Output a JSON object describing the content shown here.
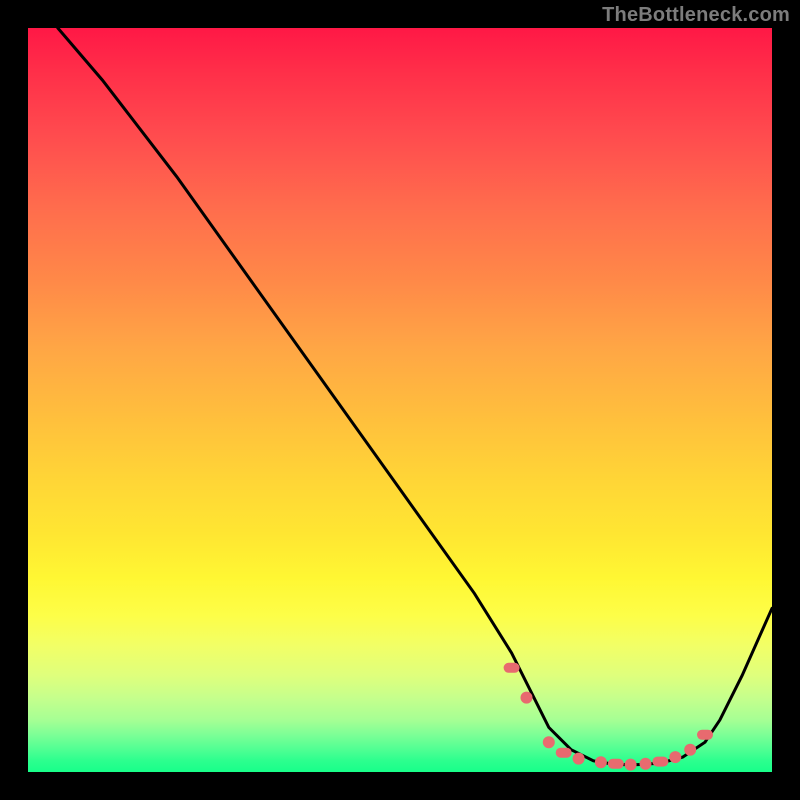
{
  "watermark": "TheBottleneck.com",
  "colors": {
    "background": "#000000",
    "gradient_top": "#ff1846",
    "gradient_mid": "#ffe632",
    "gradient_bottom": "#18ff8a",
    "curve": "#000000",
    "marker_fill": "#e86a6f",
    "marker_stroke": "#000000"
  },
  "chart_data": {
    "type": "line",
    "title": "",
    "xlabel": "",
    "ylabel": "",
    "xlim": [
      0,
      100
    ],
    "ylim": [
      0,
      100
    ],
    "series": [
      {
        "name": "bottleneck-curve",
        "x": [
          4,
          10,
          20,
          30,
          40,
          50,
          60,
          65,
          68,
          70,
          73,
          76,
          79,
          82,
          85,
          88,
          91,
          93,
          96,
          100
        ],
        "values": [
          100,
          93,
          80,
          66,
          52,
          38,
          24,
          16,
          10,
          6,
          3,
          1.5,
          1,
          1,
          1.2,
          2,
          4,
          7,
          13,
          22
        ]
      }
    ],
    "markers": {
      "name": "highlight-dots",
      "x": [
        65,
        67,
        70,
        72,
        74,
        77,
        79,
        81,
        83,
        85,
        87,
        89,
        91
      ],
      "values": [
        14,
        10,
        4,
        2.6,
        1.8,
        1.3,
        1.1,
        1.0,
        1.1,
        1.4,
        2.0,
        3.0,
        5.0
      ]
    }
  }
}
